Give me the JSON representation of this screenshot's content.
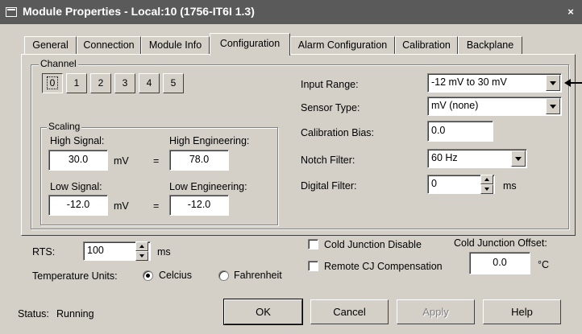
{
  "window": {
    "title": "Module Properties - Local:10 (1756-IT6I 1.3)",
    "close": "×"
  },
  "tabs": [
    "General",
    "Connection",
    "Module Info",
    "Configuration",
    "Alarm Configuration",
    "Calibration",
    "Backplane"
  ],
  "active_tab": "Configuration",
  "channel": {
    "legend": "Channel",
    "buttons": [
      "0",
      "1",
      "2",
      "3",
      "4",
      "5"
    ],
    "selected": "0"
  },
  "scaling": {
    "legend": "Scaling",
    "high_signal_label": "High Signal:",
    "high_signal_value": "30.0",
    "high_signal_unit": "mV",
    "high_eng_label": "High Engineering:",
    "high_eng_value": "78.0",
    "low_signal_label": "Low Signal:",
    "low_signal_value": "-12.0",
    "low_signal_unit": "mV",
    "low_eng_label": "Low Engineering:",
    "low_eng_value": "-12.0",
    "equals": "="
  },
  "config": {
    "input_range_label": "Input Range:",
    "input_range_value": "-12 mV to 30 mV",
    "sensor_type_label": "Sensor Type:",
    "sensor_type_value": "mV (none)",
    "cal_bias_label": "Calibration Bias:",
    "cal_bias_value": "0.0",
    "notch_label": "Notch Filter:",
    "notch_value": "60 Hz",
    "digital_label": "Digital Filter:",
    "digital_value": "0",
    "digital_unit": "ms"
  },
  "rts": {
    "label": "RTS:",
    "value": "100",
    "unit": "ms"
  },
  "temp_units": {
    "label": "Temperature Units:",
    "celcius": "Celcius",
    "fahrenheit": "Fahrenheit",
    "selected": "Celcius"
  },
  "cold_junction": {
    "disable_label": "Cold Junction Disable",
    "remote_label": "Remote CJ Compensation",
    "offset_label": "Cold Junction Offset:",
    "offset_value": "0.0",
    "offset_unit": "°C"
  },
  "status": {
    "label": "Status:",
    "value": "Running"
  },
  "buttons": {
    "ok": "OK",
    "cancel": "Cancel",
    "apply": "Apply",
    "help": "Help"
  }
}
